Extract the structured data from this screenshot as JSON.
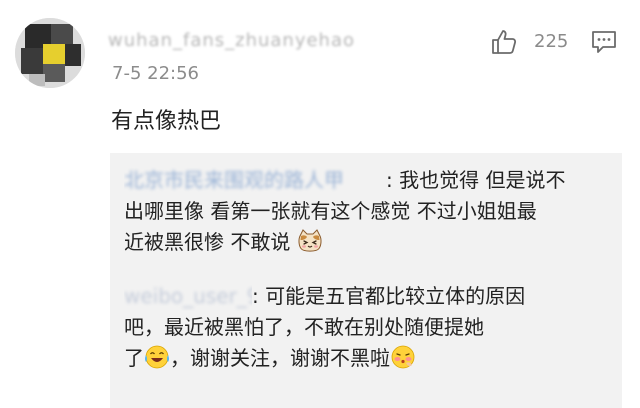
{
  "comment": {
    "username": "wuhan_fans_zhuanyehao",
    "timestamp": "7-5 22:56",
    "like_count": "225",
    "text": "有点像热巴"
  },
  "replies": [
    {
      "user": "北京市民来围观的路人甲",
      "lines": [
        ": 我也觉得 但是说不",
        "出哪里像 看第一张就有这个感觉 不过小姐姐最",
        "近被黑很惨 不敢说"
      ],
      "emoji": "cat-face"
    },
    {
      "user": "weibo_user_9",
      "lines": [
        ": 可能是五官都比较立体的原因",
        "吧，最近被黑怕了，不敢在别处随便提她",
        "了",
        "，谢谢关注，谢谢不黑啦"
      ],
      "emojis": [
        "laughing-tears",
        "shy-face"
      ]
    }
  ],
  "icons": {
    "like": "thumbs-up-icon",
    "reply": "comment-bubble-icon"
  },
  "colors": {
    "text": "#222222",
    "meta": "#8c8c8c",
    "reply_bg": "#f2f2f2",
    "link": "#9ab3d6"
  }
}
